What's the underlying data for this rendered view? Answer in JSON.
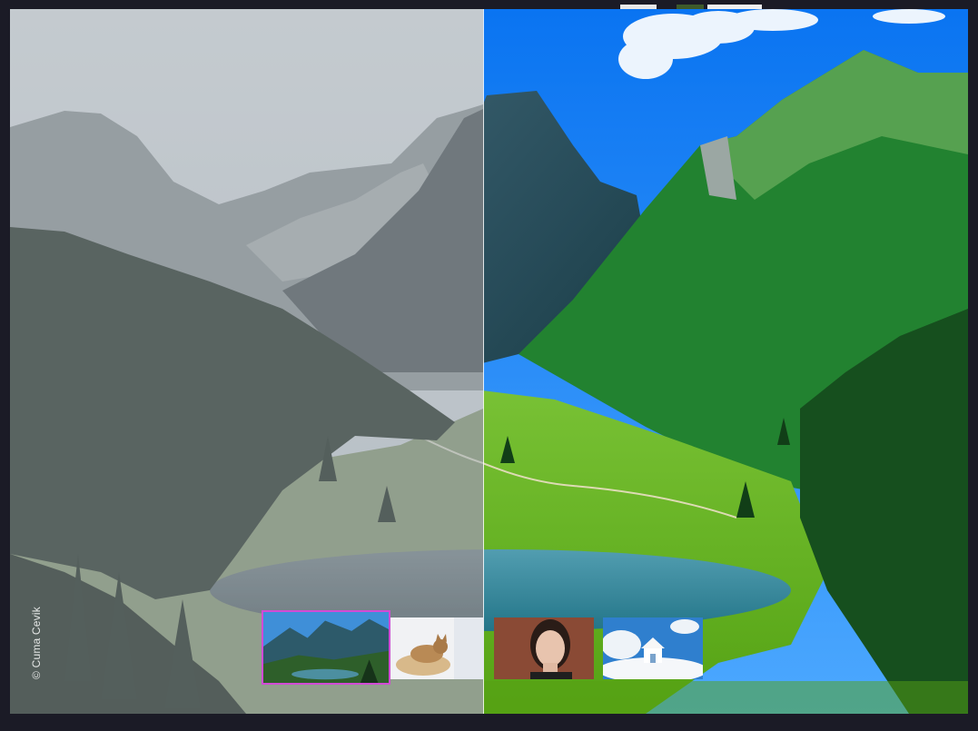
{
  "viewer": {
    "credit": "© Cuma Cevik",
    "split_position_percent": 49.4,
    "left_label": "",
    "right_label": ""
  },
  "thumbnails": [
    {
      "name": "mountain-lake",
      "selected": true
    },
    {
      "name": "cat-in-basket",
      "selected": false
    },
    {
      "name": "woman-portrait",
      "selected": false
    },
    {
      "name": "house-in-clouds",
      "selected": false
    }
  ],
  "colors": {
    "selection_border": "#d24bd6",
    "background": "#1b1b26",
    "divider": "#ffffff"
  }
}
